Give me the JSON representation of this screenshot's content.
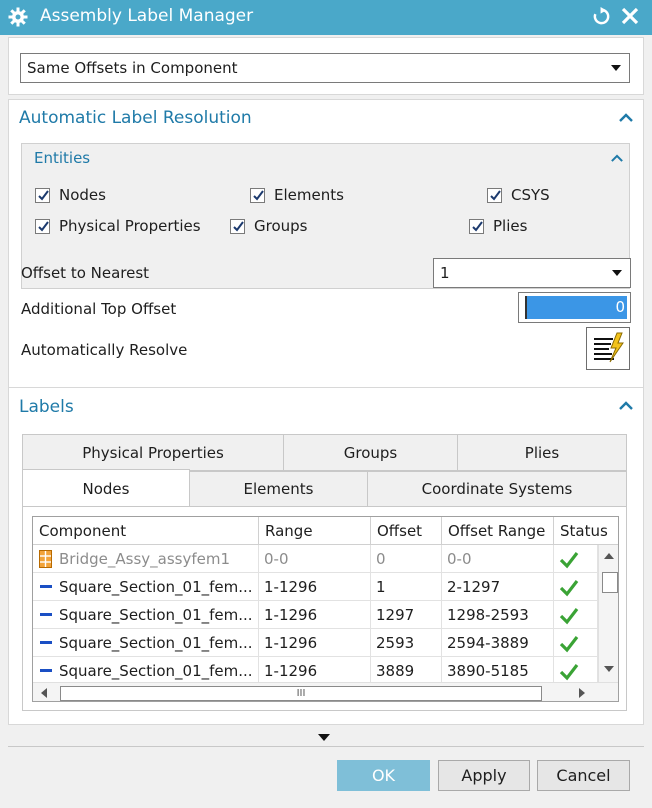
{
  "window": {
    "title": "Assembly Label Manager",
    "icons": {
      "settings": "gear-icon",
      "reset": "reset-icon",
      "close": "close-icon"
    }
  },
  "method": {
    "selected": "Same Offsets in Component"
  },
  "auto_resolution": {
    "title": "Automatic Label Resolution",
    "entities": {
      "title": "Entities",
      "items": [
        {
          "label": "Nodes",
          "checked": true
        },
        {
          "label": "Elements",
          "checked": true
        },
        {
          "label": "CSYS",
          "checked": true
        },
        {
          "label": "Physical Properties",
          "checked": true
        },
        {
          "label": "Groups",
          "checked": true
        },
        {
          "label": "Plies",
          "checked": true
        }
      ]
    },
    "offset_to_nearest": {
      "label": "Offset to Nearest",
      "value": "1"
    },
    "additional_top_offset": {
      "label": "Additional Top Offset",
      "value": "0"
    },
    "automatically_resolve": {
      "label": "Automatically Resolve"
    }
  },
  "labels": {
    "title": "Labels",
    "tabs_row1": [
      "Physical Properties",
      "Groups",
      "Plies"
    ],
    "tabs_row2": [
      "Nodes",
      "Elements",
      "Coordinate Systems"
    ],
    "active_tab": "Nodes",
    "columns": [
      "Component",
      "Range",
      "Offset",
      "Offset Range",
      "Status"
    ],
    "rows": [
      {
        "icon": "assembly-icon",
        "component": "Bridge_Assy_assyfem1",
        "range": "0-0",
        "offset": "0",
        "offset_range": "0-0",
        "status": "ok",
        "disabled": true
      },
      {
        "icon": "dash-icon",
        "component": "Square_Section_01_fem...",
        "range": "1-1296",
        "offset": "1",
        "offset_range": "2-1297",
        "status": "ok",
        "disabled": false
      },
      {
        "icon": "dash-icon",
        "component": "Square_Section_01_fem...",
        "range": "1-1296",
        "offset": "1297",
        "offset_range": "1298-2593",
        "status": "ok",
        "disabled": false
      },
      {
        "icon": "dash-icon",
        "component": "Square_Section_01_fem...",
        "range": "1-1296",
        "offset": "2593",
        "offset_range": "2594-3889",
        "status": "ok",
        "disabled": false
      },
      {
        "icon": "dash-icon",
        "component": "Square_Section_01_fem...",
        "range": "1-1296",
        "offset": "3889",
        "offset_range": "3890-5185",
        "status": "ok",
        "disabled": false
      }
    ],
    "hscroll_thumb": "III"
  },
  "buttons": {
    "ok": "OK",
    "apply": "Apply",
    "cancel": "Cancel"
  },
  "colors": {
    "titlebar": "#4aa8c9",
    "section_title": "#1f7aa8",
    "ok_button": "#7fbfd8",
    "check_green": "#3aa335"
  }
}
